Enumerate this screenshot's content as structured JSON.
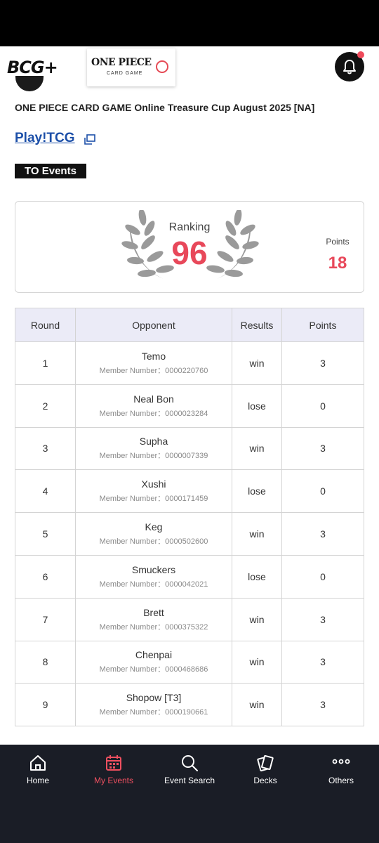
{
  "header": {
    "brand_logo": "BCG+",
    "game_logo_title": "ONE PIECE",
    "game_logo_subtitle": "CARD GAME",
    "bell_icon": "bell-icon"
  },
  "event": {
    "title": "ONE PIECE CARD GAME Online Treasure Cup August 2025 [NA]",
    "organizer_link": "Play!TCG",
    "organizer_badge": "TO Events"
  },
  "ranking": {
    "label": "Ranking",
    "value": "96",
    "points_label": "Points",
    "points_value": "18"
  },
  "table": {
    "headers": [
      "Round",
      "Opponent",
      "Results",
      "Points"
    ],
    "rows": [
      {
        "round": "1",
        "opponent": "Temo",
        "member": "Member Number：0000220760",
        "result": "win",
        "points": "3"
      },
      {
        "round": "2",
        "opponent": "Neal Bon",
        "member": "Member Number：0000023284",
        "result": "lose",
        "points": "0"
      },
      {
        "round": "3",
        "opponent": "Supha",
        "member": "Member Number：0000007339",
        "result": "win",
        "points": "3"
      },
      {
        "round": "4",
        "opponent": "Xushi",
        "member": "Member Number：0000171459",
        "result": "lose",
        "points": "0"
      },
      {
        "round": "5",
        "opponent": "Keg",
        "member": "Member Number：0000502600",
        "result": "win",
        "points": "3"
      },
      {
        "round": "6",
        "opponent": "Smuckers",
        "member": "Member Number：0000042021",
        "result": "lose",
        "points": "0"
      },
      {
        "round": "7",
        "opponent": "Brett",
        "member": "Member Number：0000375322",
        "result": "win",
        "points": "3"
      },
      {
        "round": "8",
        "opponent": "Chenpai",
        "member": "Member Number：0000468686",
        "result": "win",
        "points": "3"
      },
      {
        "round": "9",
        "opponent": "Shopow [T3]",
        "member": "Member Number：0000190661",
        "result": "win",
        "points": "3"
      }
    ]
  },
  "nav": {
    "items": [
      {
        "label": "Home",
        "icon": "home-icon"
      },
      {
        "label": "My Events",
        "icon": "calendar-icon",
        "active": true
      },
      {
        "label": "Event Search",
        "icon": "search-icon"
      },
      {
        "label": "Decks",
        "icon": "cards-icon"
      },
      {
        "label": "Others",
        "icon": "more-icon"
      }
    ]
  },
  "colors": {
    "accent": "#e8485a",
    "nav_bg": "#1a1d26",
    "link": "#1c4fa8"
  }
}
